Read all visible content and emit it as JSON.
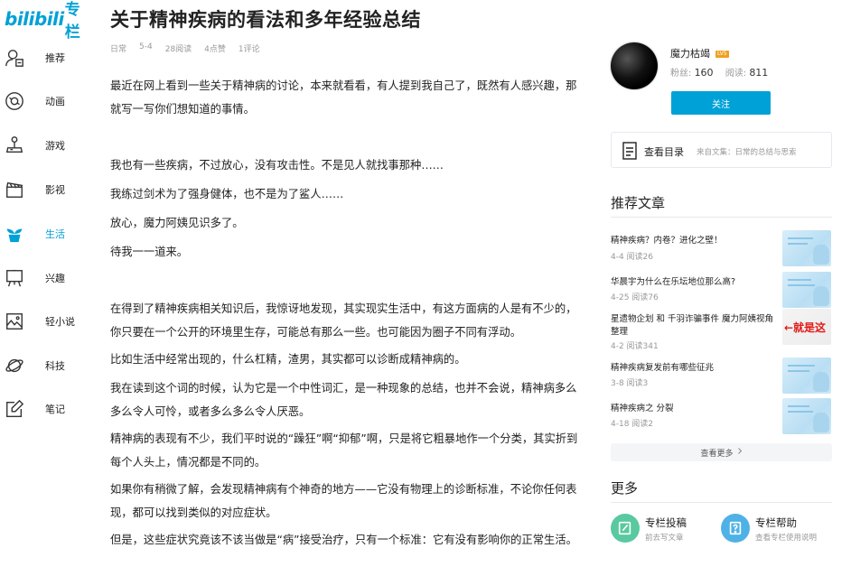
{
  "logo": {
    "bili": "bilibili",
    "zhuanlan": "专栏"
  },
  "nav": [
    {
      "label": "推荐",
      "icon": "user-recommend-icon"
    },
    {
      "label": "动画",
      "icon": "disc-icon"
    },
    {
      "label": "游戏",
      "icon": "joystick-icon"
    },
    {
      "label": "影视",
      "icon": "clapperboard-icon"
    },
    {
      "label": "生活",
      "icon": "plant-pot-icon",
      "active": true
    },
    {
      "label": "兴趣",
      "icon": "easel-icon"
    },
    {
      "label": "轻小说",
      "icon": "picture-icon"
    },
    {
      "label": "科技",
      "icon": "planet-icon"
    },
    {
      "label": "笔记",
      "icon": "note-edit-icon"
    }
  ],
  "article": {
    "title": "关于精神疾病的看法和多年经验总结",
    "meta": {
      "category": "日常",
      "date": "5-4",
      "reads": "28阅读",
      "likes": "4点赞",
      "comments": "1评论"
    },
    "paragraphs": [
      "最近在网上看到一些关于精神病的讨论，本来就看看，有人提到我自己了，既然有人感兴趣，那就写一写你们想知道的事情。",
      "我也有一些疾病，不过放心，没有攻击性。不是见人就找事那种……",
      "我练过剑术为了强身健体，也不是为了鲨人……",
      "放心，魔力阿姨见识多了。",
      "待我一一道来。",
      "在得到了精神疾病相关知识后，我惊讶地发现，其实现实生活中，有这方面病的人是有不少的，你只要在一个公开的环境里生存，可能总有那么一些。也可能因为圈子不同有浮动。",
      "比如生活中经常出现的，什么杠精，渣男，其实都可以诊断成精神病的。",
      "我在读到这个词的时候，认为它是一个中性词汇，是一种现象的总结，也并不会说，精神病多么多么令人可怜，或者多么多么令人厌恶。",
      "精神病的表现有不少，我们平时说的“躁狂”啊“抑郁”啊，只是将它粗暴地作一个分类，其实折到每个人头上，情况都是不同的。",
      "如果你有稍微了解，会发现精神病有个神奇的地方——它没有物理上的诊断标准，不论你任何表现，都可以找到类似的对应症状。",
      "但是，这些症状究竟该不该当做是“病”接受治疗，只有一个标准：它有没有影响你的正常生活。"
    ]
  },
  "author": {
    "name": "魔力枯竭",
    "level": "LV5",
    "fans_label": "粉丝:",
    "fans": "160",
    "reads_label": "阅读:",
    "reads": "811",
    "follow_label": "关注"
  },
  "toc": {
    "label": "查看目录",
    "from": "来自文集：日常的总结与思索"
  },
  "recommend": {
    "title": "推荐文章",
    "items": [
      {
        "title": "精神疾病？内卷？进化之壁！",
        "stats": "4-4 阅读26"
      },
      {
        "title": "华晨宇为什么在乐坛地位那么高?",
        "stats": "4-25 阅读76"
      },
      {
        "title": "星遗物企划 和 千羽诈骗事件 魔力阿姨视角整理",
        "stats": "4-2 阅读341",
        "thumb_text": "←就是这"
      },
      {
        "title": "精神疾病复发前有哪些征兆",
        "stats": "3-8 阅读3"
      },
      {
        "title": "精神疾病之 分裂",
        "stats": "4-18 阅读2"
      }
    ],
    "more_label": "查看更多"
  },
  "more": {
    "title": "更多",
    "tools": [
      {
        "name": "专栏投稿",
        "sub": "前去写文章",
        "icon": "pen-write-icon",
        "color": "#59c9a0"
      },
      {
        "name": "专栏帮助",
        "sub": "查看专栏使用说明",
        "icon": "help-icon",
        "color": "#4fb2e6"
      }
    ]
  }
}
